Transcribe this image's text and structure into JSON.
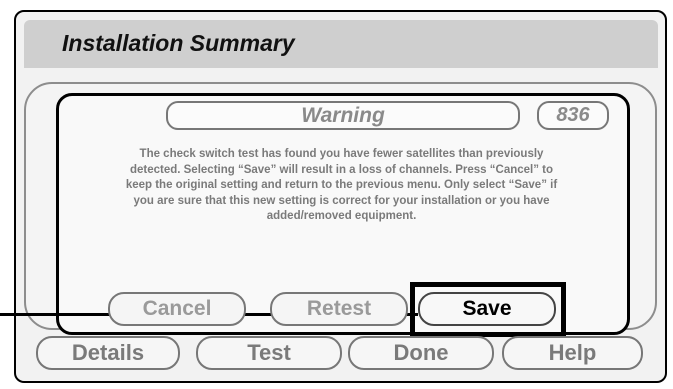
{
  "header": {
    "title": "Installation Summary"
  },
  "dialog": {
    "title": "Warning",
    "code": "836",
    "message": "The check switch test has found you have fewer satellites than previously detected. Selecting “Save” will result in a loss of channels.  Press “Cancel” to keep the original setting and return to the previous menu.  Only select “Save” if you are sure that this new setting is correct for your installation or you have added/removed equipment.",
    "buttons": {
      "cancel": "Cancel",
      "retest": "Retest",
      "save": "Save"
    }
  },
  "bottom_nav": {
    "details": "Details",
    "test": "Test",
    "done": "Done",
    "help": "Help"
  }
}
